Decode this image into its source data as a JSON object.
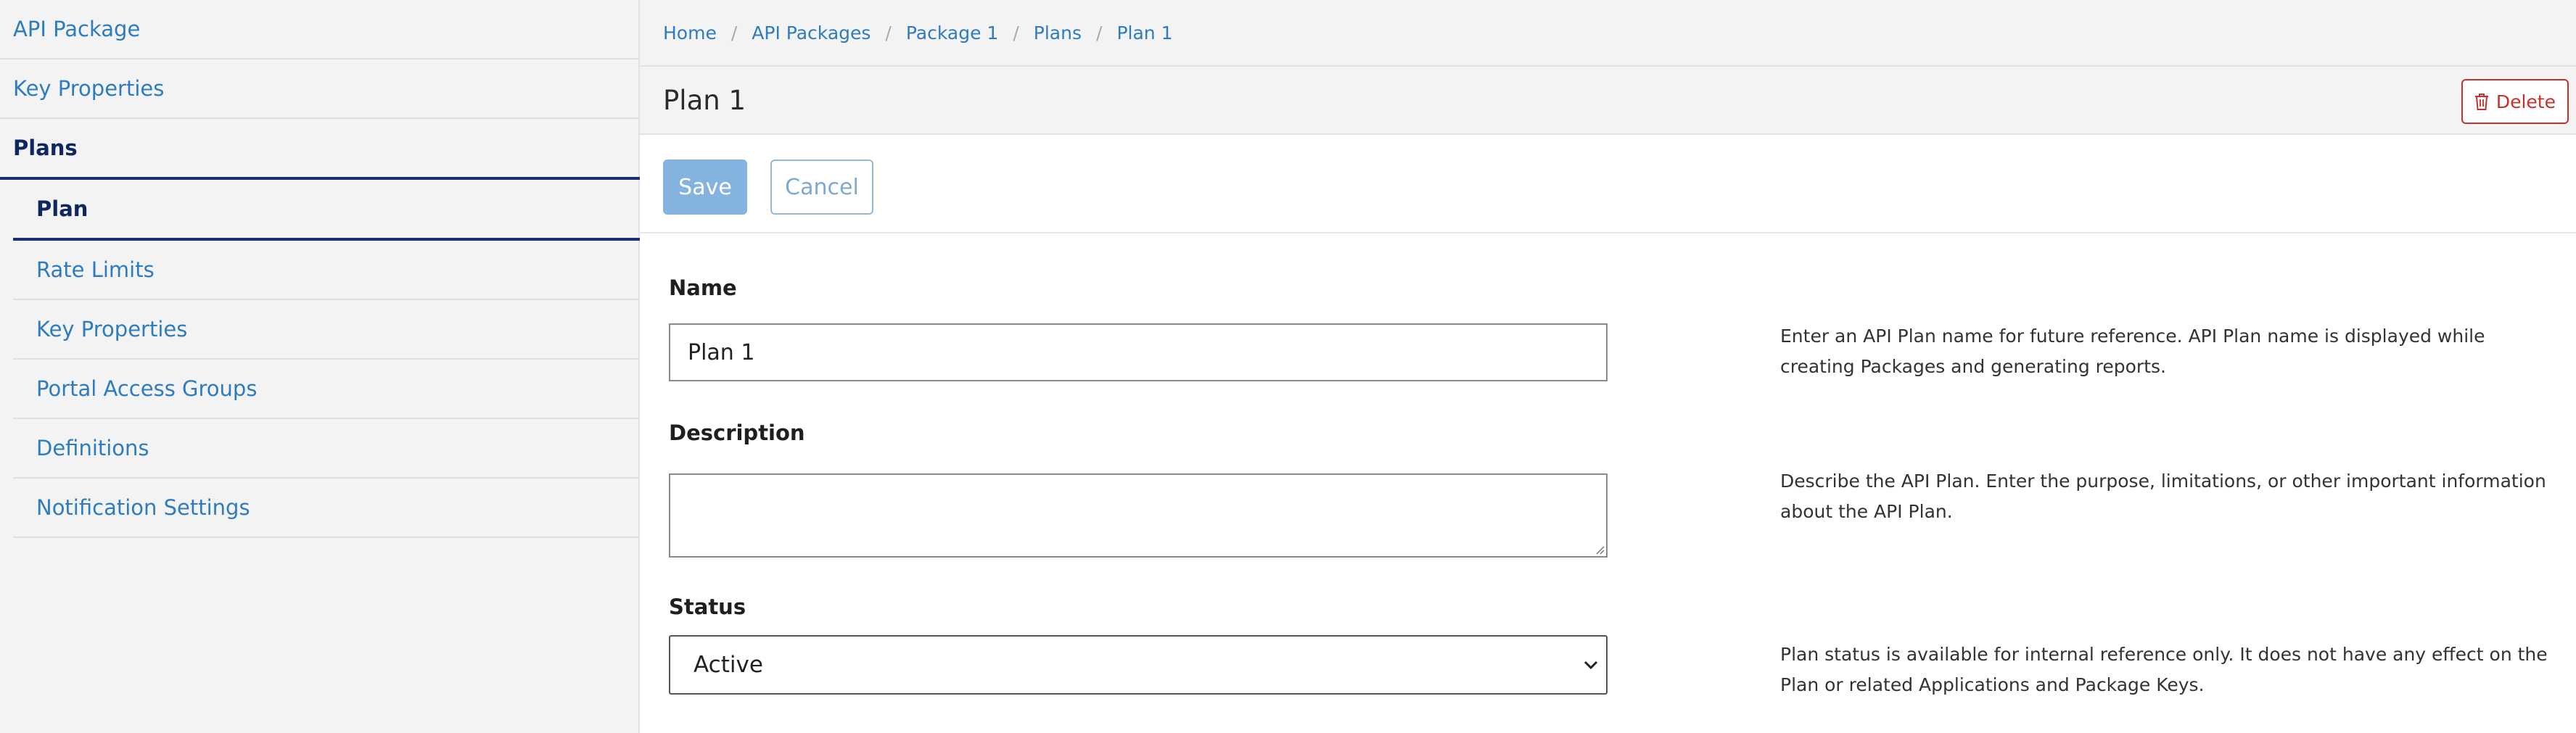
{
  "sidebar": {
    "items": [
      {
        "label": "API Package"
      },
      {
        "label": "Key Properties"
      },
      {
        "label": "Plans"
      },
      {
        "label": "Plan"
      },
      {
        "label": "Rate Limits"
      },
      {
        "label": "Key Properties"
      },
      {
        "label": "Portal Access Groups"
      },
      {
        "label": "Definitions"
      },
      {
        "label": "Notification Settings"
      }
    ]
  },
  "breadcrumb": [
    "Home",
    "API Packages",
    "Package 1",
    "Plans",
    "Plan 1"
  ],
  "breadcrumb_separator": "/",
  "header": {
    "title": "Plan 1",
    "delete_label": "Delete"
  },
  "actions": {
    "save_label": "Save",
    "cancel_label": "Cancel"
  },
  "form": {
    "name": {
      "label": "Name",
      "value": "Plan 1",
      "help": "Enter an API Plan name for future reference. API Plan name is displayed while creating Packages and generating reports."
    },
    "description": {
      "label": "Description",
      "value": "",
      "help": "Describe the API Plan. Enter the purpose, limitations, or other important information about the API Plan."
    },
    "status": {
      "label": "Status",
      "value": "Active",
      "help": "Plan status is available for internal reference only. It does not have any effect on the Plan or related Applications and Package Keys."
    }
  },
  "colors": {
    "link": "#2e7cc0",
    "active_nav": "#0f2760",
    "active_underline": "#1b2f73",
    "delete": "#c9302c",
    "save_bg": "#84b3df"
  }
}
